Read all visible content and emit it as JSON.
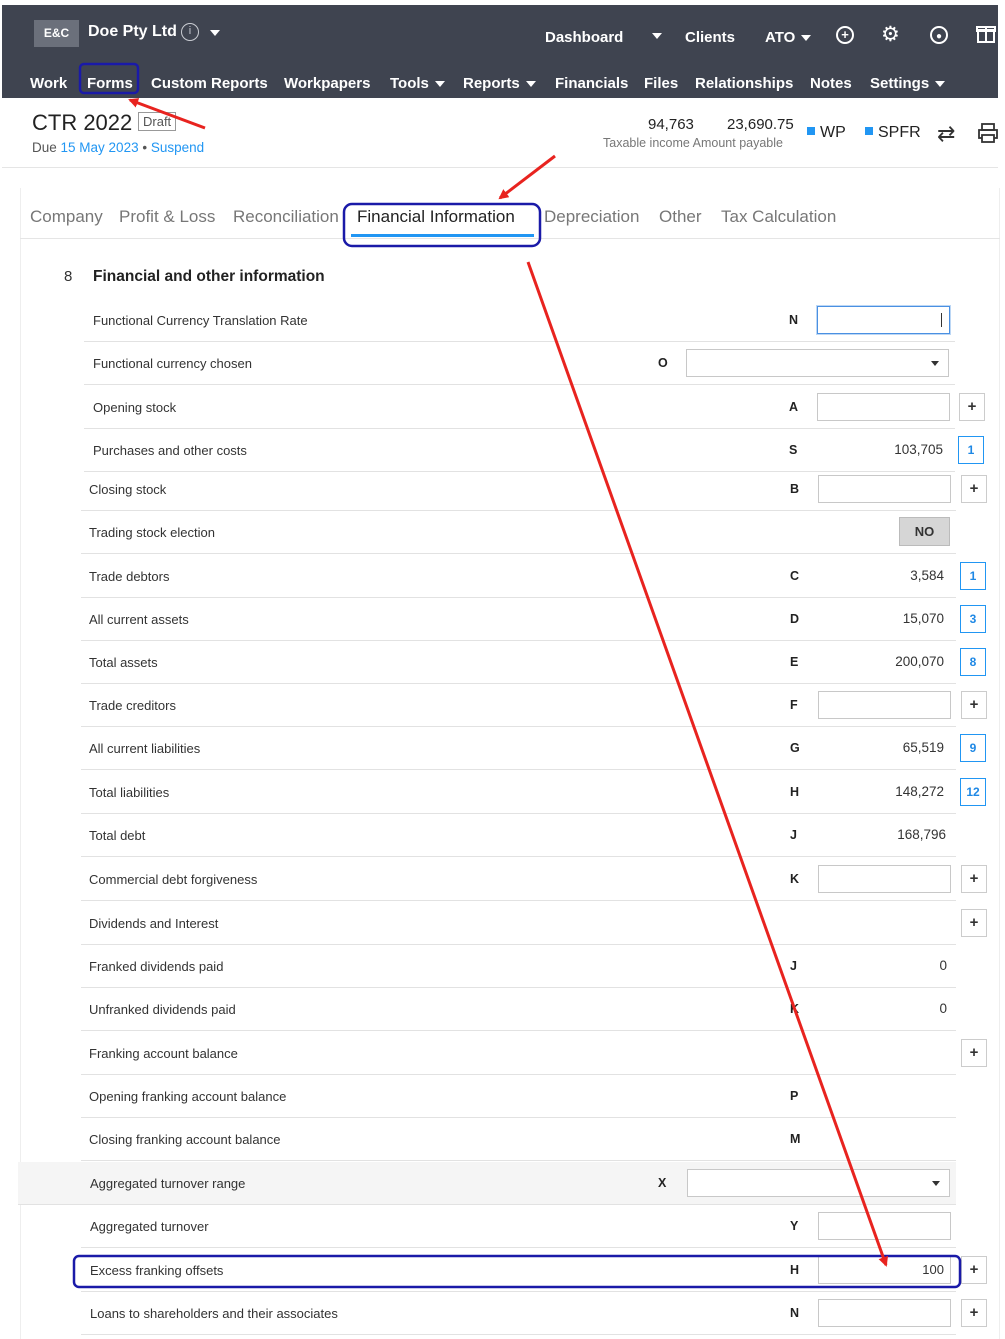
{
  "topbar": {
    "logo": "E&C",
    "client_name": "Doe Pty Ltd",
    "info_icon": "i",
    "right_nav": [
      "Dashboard",
      "Clients",
      "ATO"
    ],
    "menu": [
      "Work",
      "Forms",
      "Custom Reports",
      "Workpapers",
      "Tools",
      "Reports",
      "Financials",
      "Files",
      "Relationships",
      "Notes",
      "Settings"
    ]
  },
  "header": {
    "title": "CTR 2022",
    "status": "Draft",
    "due_prefix": "Due",
    "due_date": "15 May 2023",
    "separator": "•",
    "suspend": "Suspend",
    "taxable_income": "94,763",
    "amount_payable": "23,690.75",
    "summary_label": "Taxable income Amount payable",
    "badge_wp": "WP",
    "badge_spfr": "SPFR",
    "accent": "#2196f3"
  },
  "tabs": [
    "Company",
    "Profit & Loss",
    "Reconciliation",
    "Financial Information",
    "Depreciation",
    "Other",
    "Tax Calculation"
  ],
  "section": {
    "number": "8",
    "title": "Financial and other information"
  },
  "rows": [
    {
      "label": "Functional Currency Translation Rate",
      "code": "N",
      "value": ""
    },
    {
      "label": "Functional currency chosen",
      "code": "O",
      "value": ""
    },
    {
      "label": "Opening stock",
      "code": "A",
      "value": ""
    },
    {
      "label": "Purchases and other costs",
      "code": "S",
      "value": "103,705",
      "count": "1"
    },
    {
      "label": "Closing stock",
      "code": "B",
      "value": ""
    },
    {
      "label": "Trading stock election",
      "code": "",
      "value": "NO"
    },
    {
      "label": "Trade debtors",
      "code": "C",
      "value": "3,584",
      "count": "1"
    },
    {
      "label": "All current assets",
      "code": "D",
      "value": "15,070",
      "count": "3"
    },
    {
      "label": "Total assets",
      "code": "E",
      "value": "200,070",
      "count": "8"
    },
    {
      "label": "Trade creditors",
      "code": "F",
      "value": ""
    },
    {
      "label": "All current liabilities",
      "code": "G",
      "value": "65,519",
      "count": "9"
    },
    {
      "label": "Total liabilities",
      "code": "H",
      "value": "148,272",
      "count": "12"
    },
    {
      "label": "Total debt",
      "code": "J",
      "value": "168,796"
    },
    {
      "label": "Commercial debt forgiveness",
      "code": "K",
      "value": ""
    },
    {
      "label": "Dividends and Interest",
      "code": "",
      "value": ""
    },
    {
      "label": "Franked dividends paid",
      "code": "J",
      "value": "0"
    },
    {
      "label": "Unfranked dividends paid",
      "code": "K",
      "value": "0"
    },
    {
      "label": "Franking account balance",
      "code": "",
      "value": ""
    },
    {
      "label": "Opening franking account balance",
      "code": "P",
      "value": ""
    },
    {
      "label": "Closing franking account balance",
      "code": "M",
      "value": ""
    },
    {
      "label": "Aggregated turnover range",
      "code": "X",
      "value": ""
    },
    {
      "label": "Aggregated turnover",
      "code": "Y",
      "value": ""
    },
    {
      "label": "Excess franking offsets",
      "code": "H",
      "value": "100"
    },
    {
      "label": "Loans to shareholders and their associates",
      "code": "N",
      "value": ""
    }
  ],
  "annotation_colors": {
    "arrow": "#e8231f",
    "highlight": "#1a1aa8"
  }
}
